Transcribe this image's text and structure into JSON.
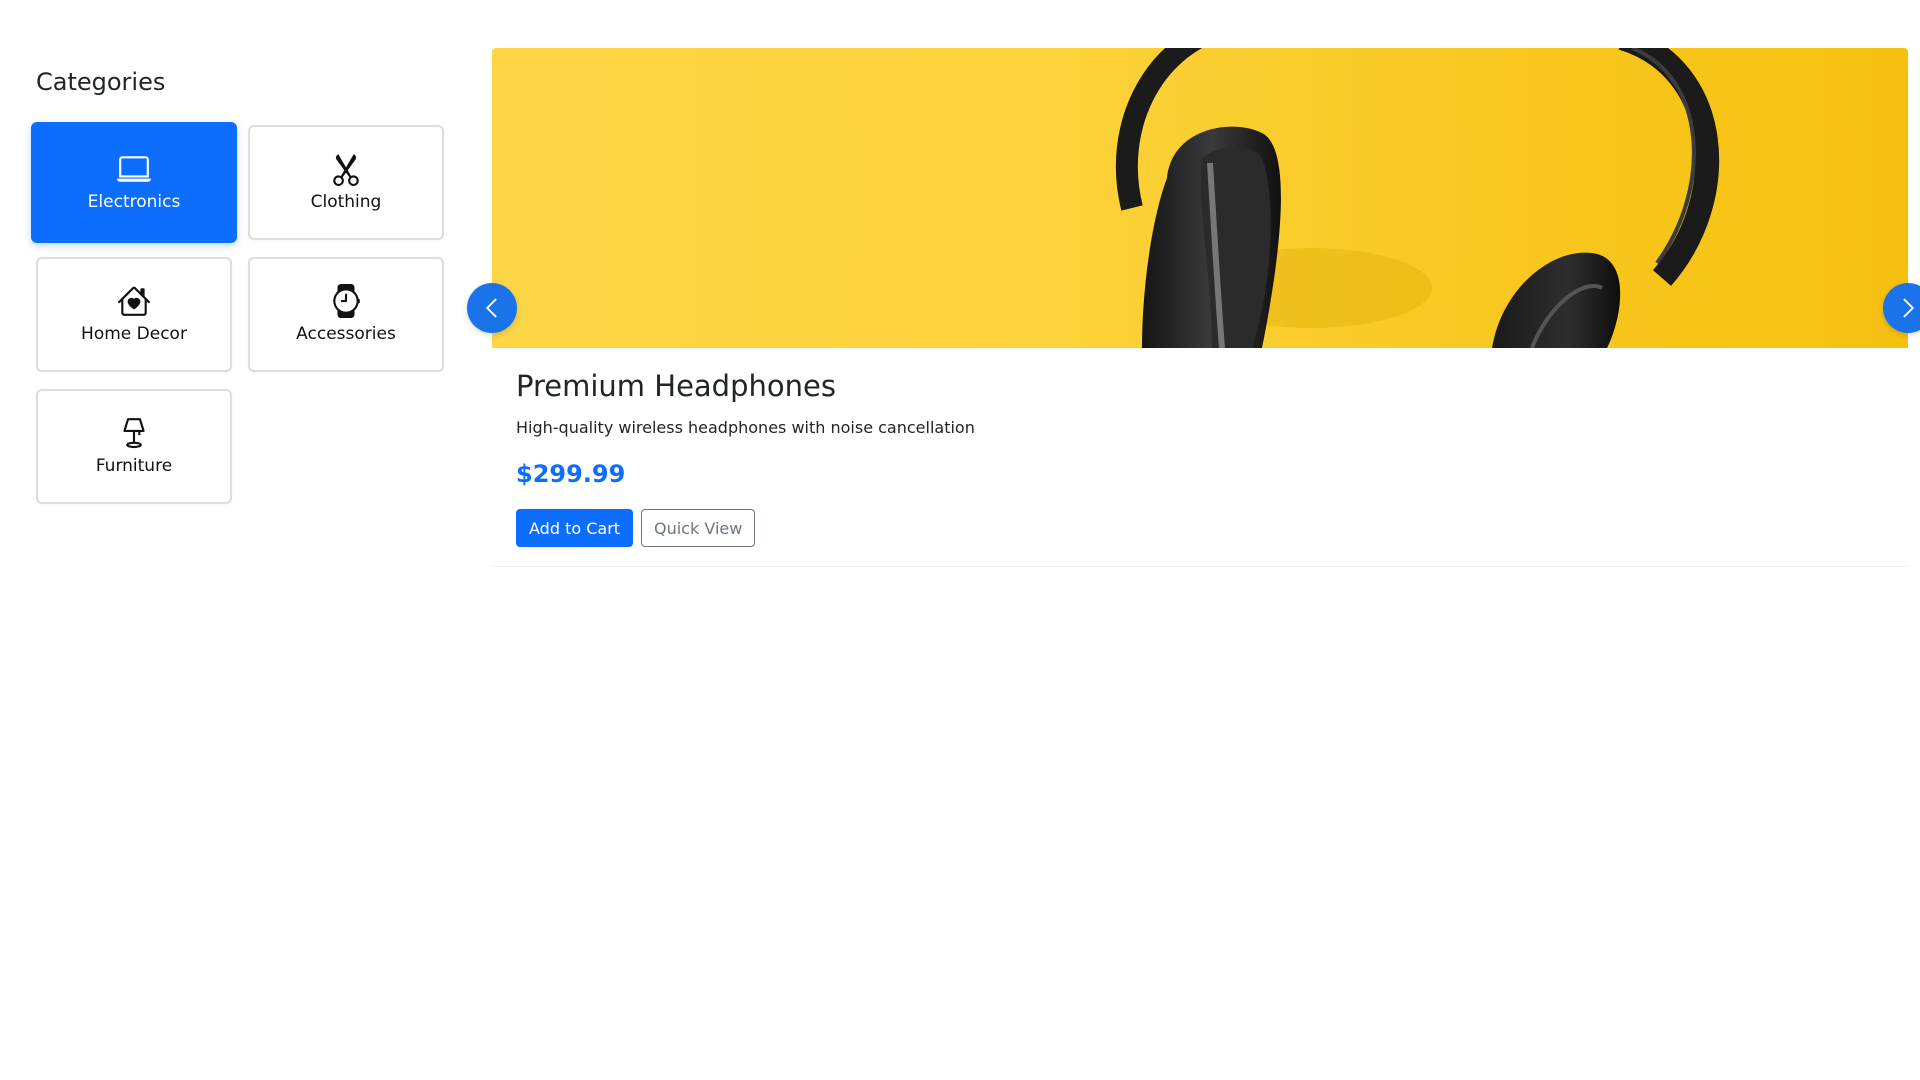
{
  "sidebar": {
    "title": "Categories",
    "categories": [
      {
        "label": "Electronics",
        "icon": "laptop-icon",
        "active": true
      },
      {
        "label": "Clothing",
        "icon": "scissors-icon",
        "active": false
      },
      {
        "label": "Home Decor",
        "icon": "house-heart-icon",
        "active": false
      },
      {
        "label": "Accessories",
        "icon": "watch-icon",
        "active": false
      },
      {
        "label": "Furniture",
        "icon": "lamp-icon",
        "active": false
      }
    ]
  },
  "carousel": {
    "image": "headphones-on-yellow-background",
    "prev_icon": "chevron-left-icon",
    "next_icon": "chevron-right-icon",
    "product": {
      "title": "Premium Headphones",
      "description": "High-quality wireless headphones with noise cancellation",
      "price": "$299.99",
      "add_to_cart_label": "Add to Cart",
      "quick_view_label": "Quick View"
    }
  },
  "colors": {
    "accent": "#0d6efd",
    "arrow": "#1a73e8",
    "banner_yellow": "#fcd23a",
    "outline_gray": "#6c757d"
  }
}
